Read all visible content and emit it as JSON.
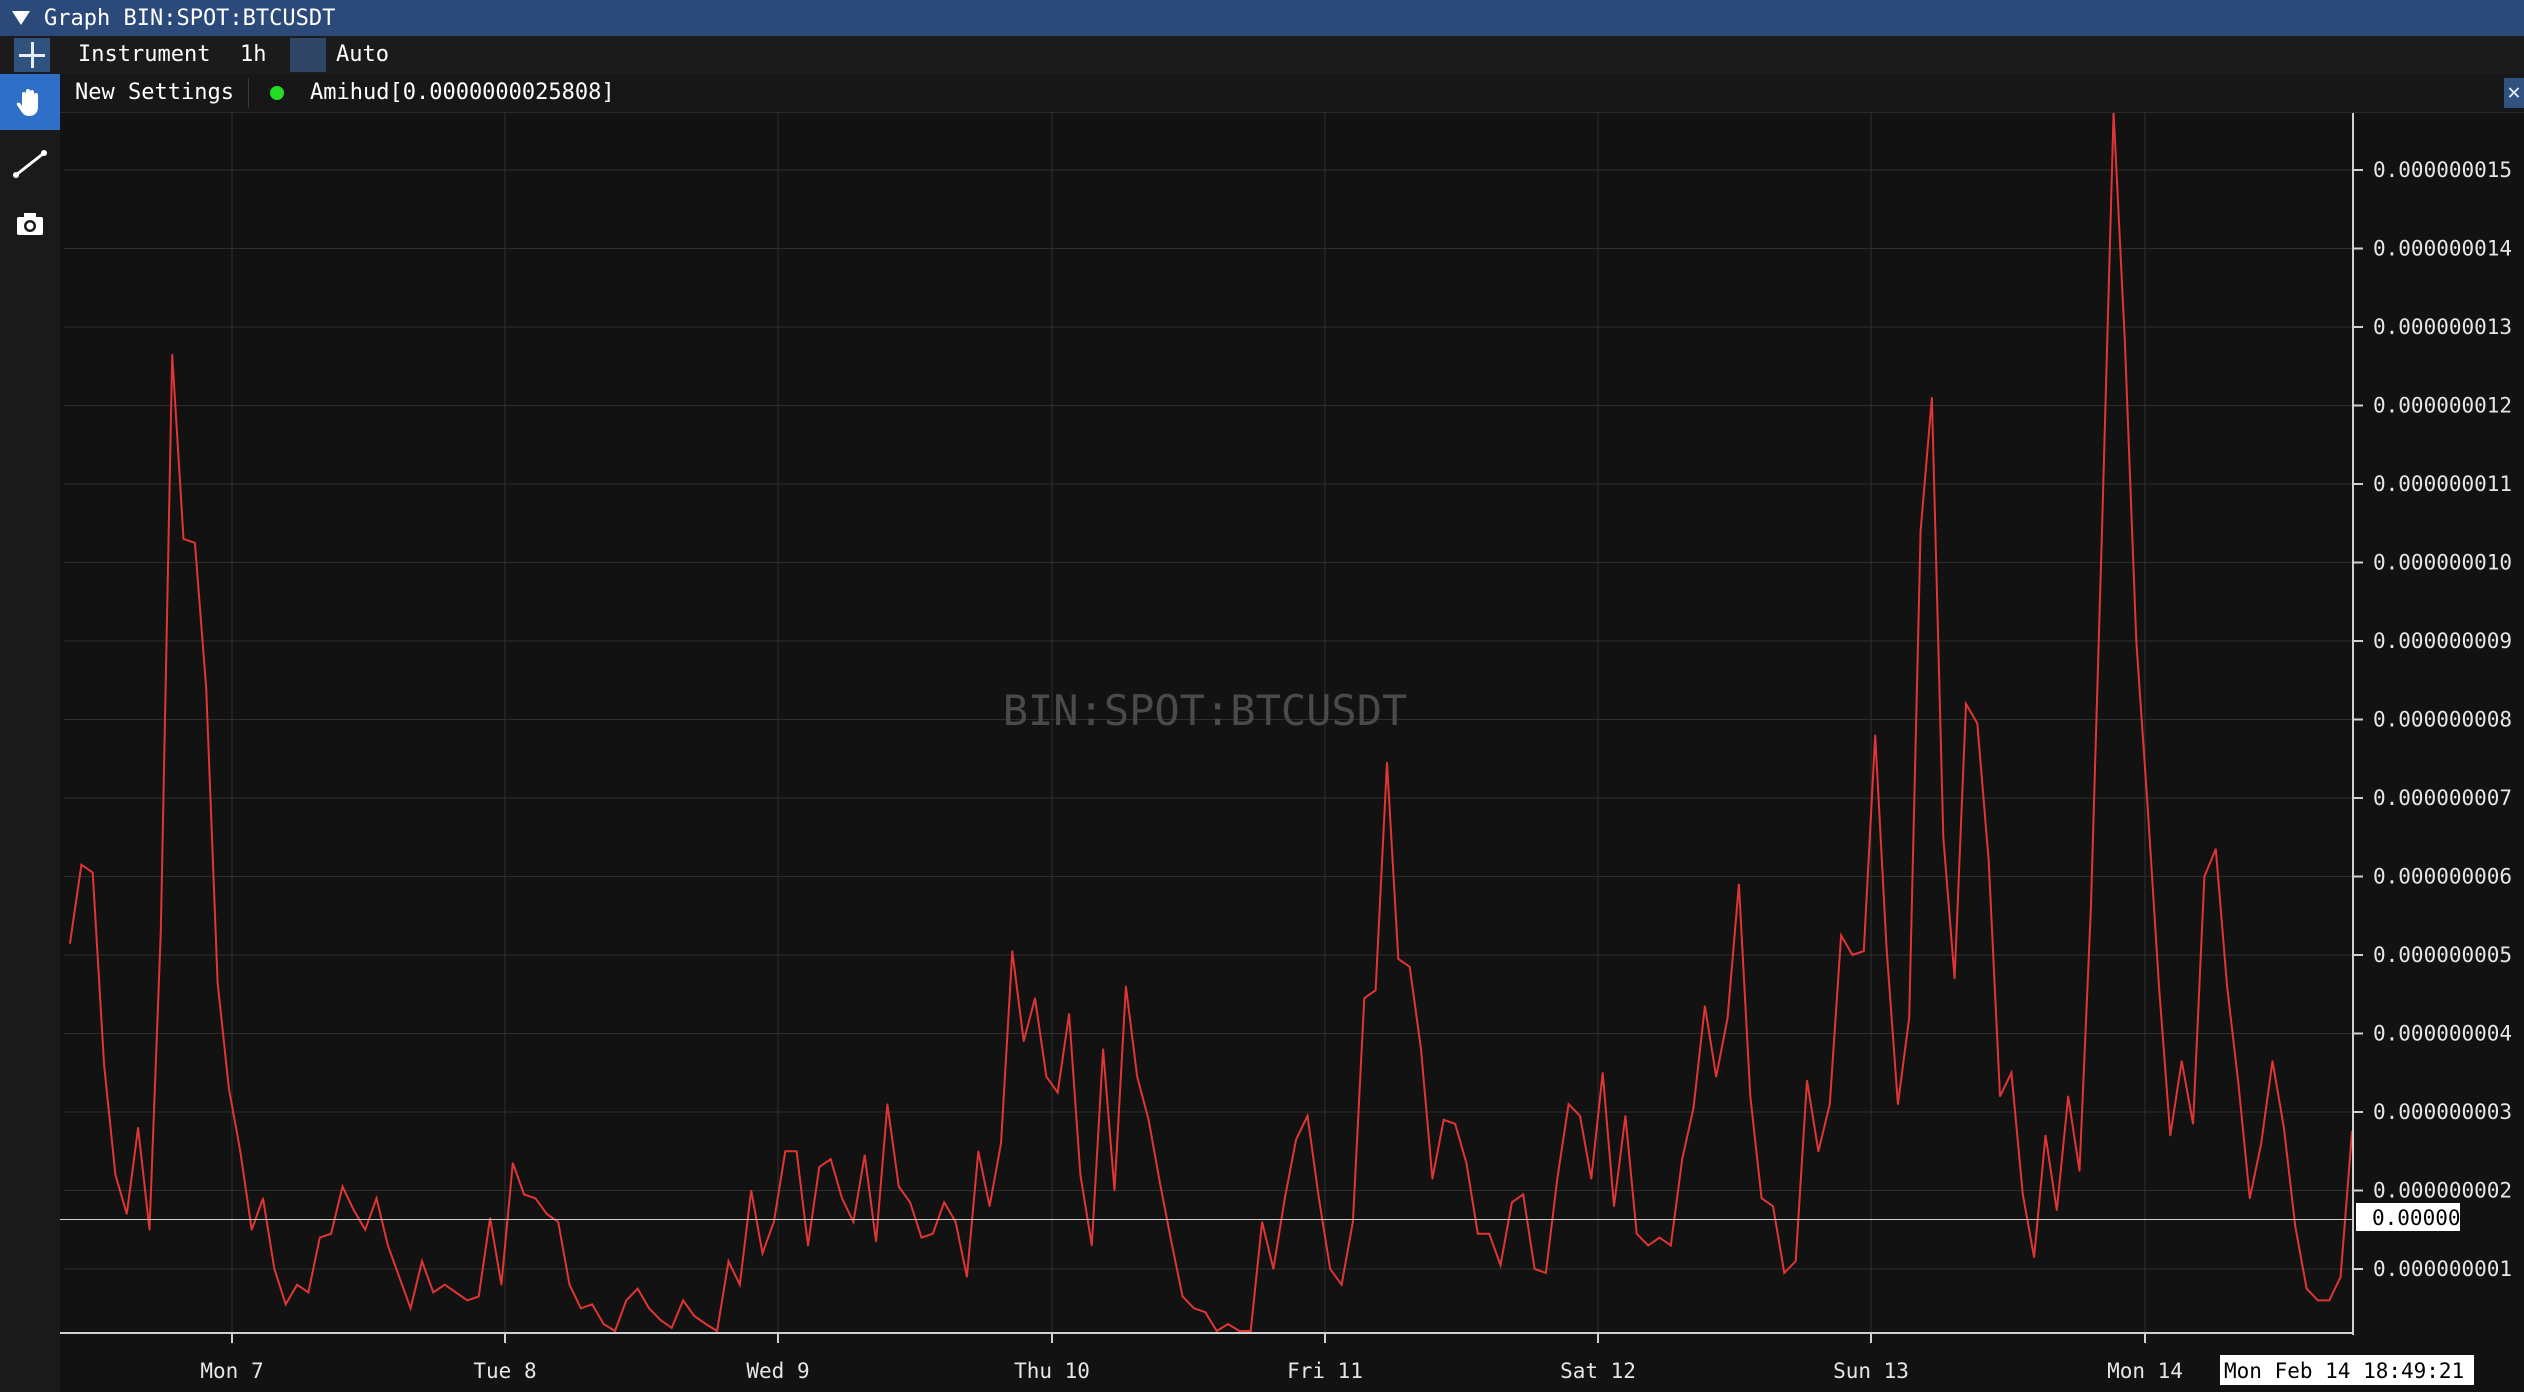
{
  "window": {
    "title": "Graph BIN:SPOT:BTCUSDT"
  },
  "toolbar": {
    "instrument_label": "Instrument",
    "interval_label": "1h",
    "scale_label": "Auto"
  },
  "indicator_bar": {
    "new_settings_label": "New Settings",
    "indicator_label": "Amihud[0.0000000025808]",
    "indicator_dot_color": "#22dd22"
  },
  "sidebar": {
    "tools": [
      "hand-icon",
      "line-tool-icon",
      "camera-icon"
    ]
  },
  "chart_data": {
    "type": "line",
    "watermark": "BIN:SPOT:BTCUSDT",
    "series_color": "#e03535",
    "x_ticks": [
      "Mon 7",
      "Tue 8",
      "Wed 9",
      "Thu 10",
      "Fri 11",
      "Sat 12",
      "Sun 13",
      "Mon 14"
    ],
    "y_ticks": [
      "0.000000001",
      "0.000000002",
      "0.000000003",
      "0.000000004",
      "0.000000005",
      "0.000000006",
      "0.000000007",
      "0.000000008",
      "0.000000009",
      "0.000000010",
      "0.000000011",
      "0.000000012",
      "0.000000013",
      "0.000000014",
      "0.000000015"
    ],
    "ylim": [
      1e-10,
      1.6e-09
    ],
    "crosshair": {
      "y_label": "0.00000",
      "x_label": "Mon Feb 14 18:49:21",
      "y_value": 1.63e-09
    },
    "values": [
      5.15,
      6.15,
      6.05,
      3.6,
      2.2,
      1.7,
      2.8,
      1.5,
      5.3,
      12.65,
      10.3,
      10.25,
      8.4,
      4.65,
      3.3,
      2.5,
      1.5,
      1.9,
      1.0,
      0.55,
      0.8,
      0.7,
      1.4,
      1.45,
      2.05,
      1.75,
      1.5,
      1.9,
      1.3,
      0.9,
      0.5,
      1.1,
      0.7,
      0.8,
      0.7,
      0.6,
      0.65,
      1.65,
      0.8,
      2.35,
      1.95,
      1.9,
      1.7,
      1.6,
      0.8,
      0.5,
      0.55,
      0.3,
      0.1,
      0.6,
      0.75,
      0.5,
      0.35,
      0.25,
      0.6,
      0.4,
      0.3,
      0.2,
      1.1,
      0.8,
      2.0,
      1.2,
      1.6,
      2.5,
      2.5,
      1.3,
      2.3,
      2.4,
      1.9,
      1.6,
      2.45,
      1.35,
      3.1,
      2.05,
      1.85,
      1.4,
      1.45,
      1.85,
      1.6,
      0.9,
      2.5,
      1.8,
      2.6,
      5.05,
      3.9,
      4.45,
      3.45,
      3.25,
      4.25,
      2.2,
      1.3,
      3.8,
      2.0,
      4.6,
      3.45,
      2.9,
      2.1,
      1.35,
      0.65,
      0.5,
      0.45,
      0.2,
      0.3,
      0.1,
      0.15,
      1.6,
      1.0,
      1.9,
      2.65,
      2.95,
      1.9,
      1.0,
      0.8,
      1.6,
      4.45,
      4.55,
      7.45,
      4.95,
      4.85,
      3.8,
      2.15,
      2.9,
      2.85,
      2.35,
      1.45,
      1.45,
      1.05,
      1.85,
      1.95,
      1.0,
      0.95,
      2.15,
      3.1,
      2.95,
      2.15,
      3.5,
      1.8,
      2.95,
      1.45,
      1.3,
      1.4,
      1.3,
      2.4,
      3.05,
      4.35,
      3.45,
      4.2,
      5.9,
      3.2,
      1.9,
      1.8,
      0.95,
      1.1,
      3.4,
      2.5,
      3.1,
      5.25,
      5.0,
      5.05,
      7.8,
      5.1,
      3.1,
      4.2,
      10.4,
      12.1,
      6.5,
      4.7,
      8.2,
      7.95,
      6.2,
      3.2,
      3.5,
      1.95,
      1.15,
      2.7,
      1.75,
      3.2,
      2.25,
      5.6,
      10.5,
      15.8,
      12.8,
      9.0,
      6.9,
      4.6,
      2.7,
      3.65,
      2.85,
      6.0,
      6.35,
      4.6,
      3.35,
      1.9,
      2.6,
      3.65,
      2.8,
      1.55,
      0.75,
      0.6,
      0.6,
      0.9,
      2.75
    ]
  }
}
